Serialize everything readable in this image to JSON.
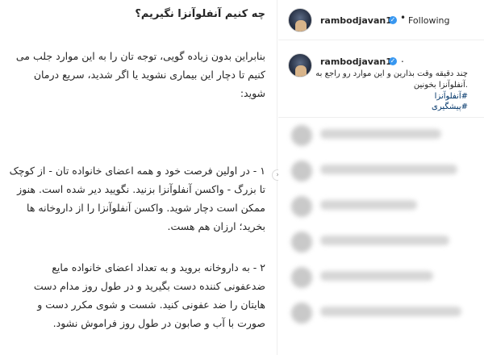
{
  "post_image": {
    "heading": "چه کنیم آنفلوآنزا نگیریم؟",
    "paragraph1": "بنابراین بدون زیاده گویی، توجه تان را به این موارد جلب می کنیم تا دچار این بیماری نشوید یا اگر شدید، سریع درمان شوید:",
    "paragraph2": "۱ - در اولین فرصت خود و همه اعضای خانواده تان - از کوچک تا بزرگ - واکسن آنفلوآنزا بزنید. نگویید دیر شده است. هنوز ممکن است دچار شوید. واکسن آنفلوآنزا را از داروخانه ها بخرید؛ ارزان هم هست.",
    "paragraph3": "۲ - به داروخانه بروید و به تعداد اعضای خانواده مایع ضدعفونی کننده دست بگیرید و در طول روز مدام دست هایتان را ضد عفونی کنید. شست و شوی مکرر دست و صورت با آب و صابون در طول روز فراموش نشود.",
    "next_icon": "›"
  },
  "header": {
    "username": "rambodjavan1",
    "verified_icon": "✓",
    "separator": "•",
    "follow_label": "Following"
  },
  "caption": {
    "username": "rambodjavan1",
    "verified_icon": "✓",
    "separator": ".",
    "line1": "چند دقیقه وقت بذارین و این موارد رو راجع به",
    "line2": ".آنفلوآنزا بخونین",
    "hashtag1": "#آنفلوآنزا",
    "hashtag2": "#پیشگیری"
  },
  "colors": {
    "text": "#262626",
    "verified": "#3897f0",
    "hashtag": "#003569",
    "border": "#efefef"
  }
}
